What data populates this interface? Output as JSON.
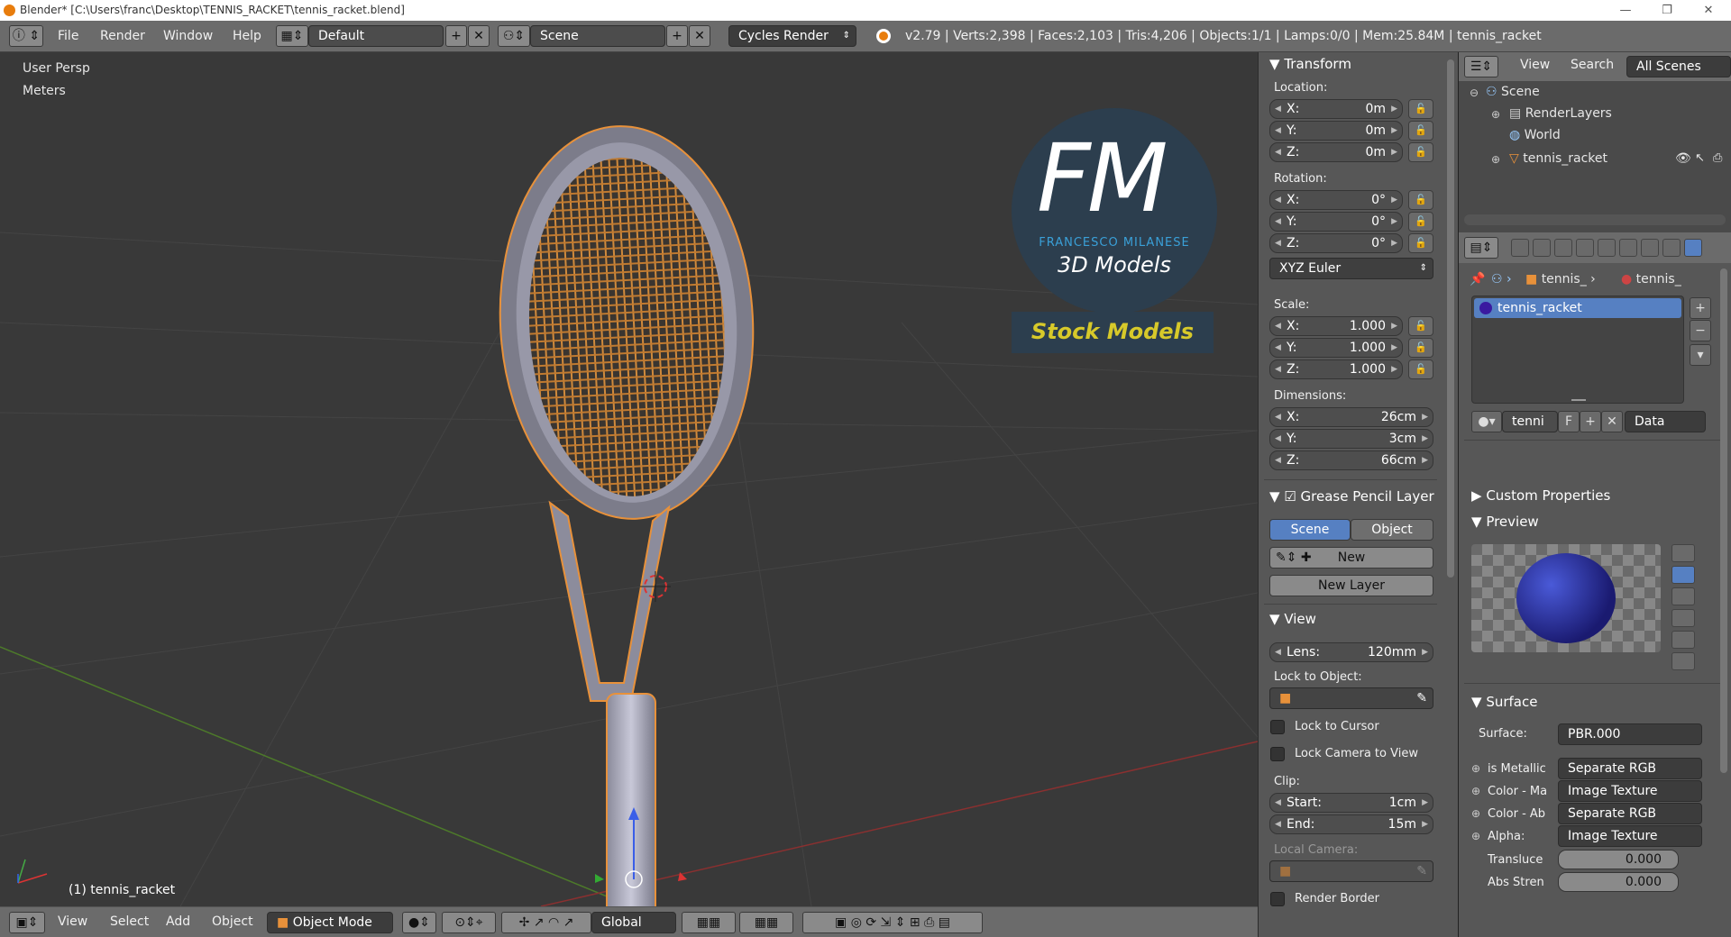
{
  "titlebar": {
    "text": "Blender* [C:\\Users\\franc\\Desktop\\TENNIS_RACKET\\tennis_racket.blend]",
    "min": "—",
    "max": "❐",
    "close": "✕"
  },
  "header": {
    "menus": [
      "File",
      "Render",
      "Window",
      "Help"
    ],
    "layout": "Default",
    "scene": "Scene",
    "engine": "Cycles Render",
    "stats": "v2.79 | Verts:2,398 | Faces:2,103 | Tris:4,206 | Objects:1/1 | Lamps:0/0 | Mem:25.84M | tennis_racket",
    "add": "+",
    "del": "✕"
  },
  "viewport": {
    "view_name": "User Persp",
    "units": "Meters",
    "object_label": "(1) tennis_racket"
  },
  "watermark": {
    "logo_letters": "FM",
    "name": "FRANCESCO MILANESE",
    "sub": "3D Models",
    "tag": "Stock Models"
  },
  "bottombar": {
    "menus": [
      "View",
      "Select",
      "Add",
      "Object"
    ],
    "mode": "Object Mode",
    "orientation": "Global"
  },
  "transform": {
    "title": "Transform",
    "location_label": "Location:",
    "location": [
      {
        "k": "X:",
        "v": "0m"
      },
      {
        "k": "Y:",
        "v": "0m"
      },
      {
        "k": "Z:",
        "v": "0m"
      }
    ],
    "rotation_label": "Rotation:",
    "rotation": [
      {
        "k": "X:",
        "v": "0°"
      },
      {
        "k": "Y:",
        "v": "0°"
      },
      {
        "k": "Z:",
        "v": "0°"
      }
    ],
    "rotation_mode": "XYZ Euler",
    "scale_label": "Scale:",
    "scale": [
      {
        "k": "X:",
        "v": "1.000"
      },
      {
        "k": "Y:",
        "v": "1.000"
      },
      {
        "k": "Z:",
        "v": "1.000"
      }
    ],
    "dimensions_label": "Dimensions:",
    "dimensions": [
      {
        "k": "X:",
        "v": "26cm"
      },
      {
        "k": "Y:",
        "v": "3cm"
      },
      {
        "k": "Z:",
        "v": "66cm"
      }
    ]
  },
  "grease": {
    "title": "Grease Pencil Layer",
    "scene_tab": "Scene",
    "object_tab": "Object",
    "new": "New",
    "new_layer": "New Layer"
  },
  "view": {
    "title": "View",
    "lens_label": "Lens:",
    "lens": "120mm",
    "lock_obj": "Lock to Object:",
    "lock_cursor": "Lock to Cursor",
    "lock_camera": "Lock Camera to View",
    "clip": "Clip:",
    "start_label": "Start:",
    "start": "1cm",
    "end_label": "End:",
    "end": "15m",
    "local_camera": "Local Camera:",
    "render_border": "Render Border"
  },
  "outliner": {
    "view": "View",
    "search": "Search",
    "filter": "All Scenes",
    "items": [
      "Scene",
      "RenderLayers",
      "World",
      "tennis_racket"
    ]
  },
  "props": {
    "crumbs": [
      "tennis_",
      "tennis_"
    ],
    "material": "tennis_racket",
    "mat_field": "tenni",
    "fake": "F",
    "data": "Data",
    "custom_props": "Custom Properties",
    "preview": "Preview",
    "surface_title": "Surface",
    "surface_label": "Surface:",
    "surface_value": "PBR.000",
    "inputs": [
      {
        "label": "is Metallic",
        "value": "Separate RGB"
      },
      {
        "label": "Color - Ma",
        "value": "Image Texture"
      },
      {
        "label": "Color - Ab",
        "value": "Separate RGB"
      },
      {
        "label": "Alpha:",
        "value": "Image Texture"
      }
    ],
    "translucence_label": "Transluce",
    "translucence": "0.000",
    "abs_label": "Abs Stren",
    "abs": "0.000"
  }
}
